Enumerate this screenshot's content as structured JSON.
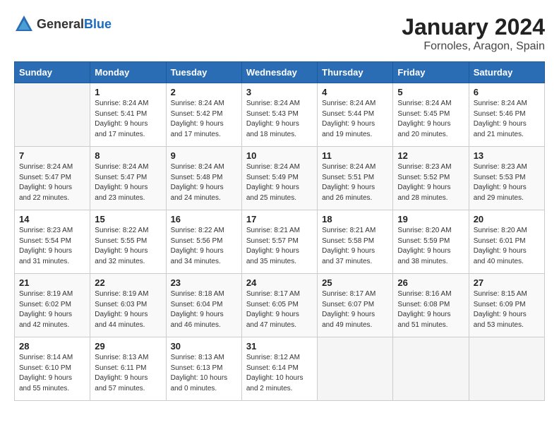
{
  "header": {
    "logo_general": "General",
    "logo_blue": "Blue",
    "month_title": "January 2024",
    "location": "Fornoles, Aragon, Spain"
  },
  "days_of_week": [
    "Sunday",
    "Monday",
    "Tuesday",
    "Wednesday",
    "Thursday",
    "Friday",
    "Saturday"
  ],
  "weeks": [
    [
      {
        "day": "",
        "sunrise": "",
        "sunset": "",
        "daylight": ""
      },
      {
        "day": "1",
        "sunrise": "Sunrise: 8:24 AM",
        "sunset": "Sunset: 5:41 PM",
        "daylight": "Daylight: 9 hours and 17 minutes."
      },
      {
        "day": "2",
        "sunrise": "Sunrise: 8:24 AM",
        "sunset": "Sunset: 5:42 PM",
        "daylight": "Daylight: 9 hours and 17 minutes."
      },
      {
        "day": "3",
        "sunrise": "Sunrise: 8:24 AM",
        "sunset": "Sunset: 5:43 PM",
        "daylight": "Daylight: 9 hours and 18 minutes."
      },
      {
        "day": "4",
        "sunrise": "Sunrise: 8:24 AM",
        "sunset": "Sunset: 5:44 PM",
        "daylight": "Daylight: 9 hours and 19 minutes."
      },
      {
        "day": "5",
        "sunrise": "Sunrise: 8:24 AM",
        "sunset": "Sunset: 5:45 PM",
        "daylight": "Daylight: 9 hours and 20 minutes."
      },
      {
        "day": "6",
        "sunrise": "Sunrise: 8:24 AM",
        "sunset": "Sunset: 5:46 PM",
        "daylight": "Daylight: 9 hours and 21 minutes."
      }
    ],
    [
      {
        "day": "7",
        "sunrise": "Sunrise: 8:24 AM",
        "sunset": "Sunset: 5:47 PM",
        "daylight": "Daylight: 9 hours and 22 minutes."
      },
      {
        "day": "8",
        "sunrise": "Sunrise: 8:24 AM",
        "sunset": "Sunset: 5:47 PM",
        "daylight": "Daylight: 9 hours and 23 minutes."
      },
      {
        "day": "9",
        "sunrise": "Sunrise: 8:24 AM",
        "sunset": "Sunset: 5:48 PM",
        "daylight": "Daylight: 9 hours and 24 minutes."
      },
      {
        "day": "10",
        "sunrise": "Sunrise: 8:24 AM",
        "sunset": "Sunset: 5:49 PM",
        "daylight": "Daylight: 9 hours and 25 minutes."
      },
      {
        "day": "11",
        "sunrise": "Sunrise: 8:24 AM",
        "sunset": "Sunset: 5:51 PM",
        "daylight": "Daylight: 9 hours and 26 minutes."
      },
      {
        "day": "12",
        "sunrise": "Sunrise: 8:23 AM",
        "sunset": "Sunset: 5:52 PM",
        "daylight": "Daylight: 9 hours and 28 minutes."
      },
      {
        "day": "13",
        "sunrise": "Sunrise: 8:23 AM",
        "sunset": "Sunset: 5:53 PM",
        "daylight": "Daylight: 9 hours and 29 minutes."
      }
    ],
    [
      {
        "day": "14",
        "sunrise": "Sunrise: 8:23 AM",
        "sunset": "Sunset: 5:54 PM",
        "daylight": "Daylight: 9 hours and 31 minutes."
      },
      {
        "day": "15",
        "sunrise": "Sunrise: 8:22 AM",
        "sunset": "Sunset: 5:55 PM",
        "daylight": "Daylight: 9 hours and 32 minutes."
      },
      {
        "day": "16",
        "sunrise": "Sunrise: 8:22 AM",
        "sunset": "Sunset: 5:56 PM",
        "daylight": "Daylight: 9 hours and 34 minutes."
      },
      {
        "day": "17",
        "sunrise": "Sunrise: 8:21 AM",
        "sunset": "Sunset: 5:57 PM",
        "daylight": "Daylight: 9 hours and 35 minutes."
      },
      {
        "day": "18",
        "sunrise": "Sunrise: 8:21 AM",
        "sunset": "Sunset: 5:58 PM",
        "daylight": "Daylight: 9 hours and 37 minutes."
      },
      {
        "day": "19",
        "sunrise": "Sunrise: 8:20 AM",
        "sunset": "Sunset: 5:59 PM",
        "daylight": "Daylight: 9 hours and 38 minutes."
      },
      {
        "day": "20",
        "sunrise": "Sunrise: 8:20 AM",
        "sunset": "Sunset: 6:01 PM",
        "daylight": "Daylight: 9 hours and 40 minutes."
      }
    ],
    [
      {
        "day": "21",
        "sunrise": "Sunrise: 8:19 AM",
        "sunset": "Sunset: 6:02 PM",
        "daylight": "Daylight: 9 hours and 42 minutes."
      },
      {
        "day": "22",
        "sunrise": "Sunrise: 8:19 AM",
        "sunset": "Sunset: 6:03 PM",
        "daylight": "Daylight: 9 hours and 44 minutes."
      },
      {
        "day": "23",
        "sunrise": "Sunrise: 8:18 AM",
        "sunset": "Sunset: 6:04 PM",
        "daylight": "Daylight: 9 hours and 46 minutes."
      },
      {
        "day": "24",
        "sunrise": "Sunrise: 8:17 AM",
        "sunset": "Sunset: 6:05 PM",
        "daylight": "Daylight: 9 hours and 47 minutes."
      },
      {
        "day": "25",
        "sunrise": "Sunrise: 8:17 AM",
        "sunset": "Sunset: 6:07 PM",
        "daylight": "Daylight: 9 hours and 49 minutes."
      },
      {
        "day": "26",
        "sunrise": "Sunrise: 8:16 AM",
        "sunset": "Sunset: 6:08 PM",
        "daylight": "Daylight: 9 hours and 51 minutes."
      },
      {
        "day": "27",
        "sunrise": "Sunrise: 8:15 AM",
        "sunset": "Sunset: 6:09 PM",
        "daylight": "Daylight: 9 hours and 53 minutes."
      }
    ],
    [
      {
        "day": "28",
        "sunrise": "Sunrise: 8:14 AM",
        "sunset": "Sunset: 6:10 PM",
        "daylight": "Daylight: 9 hours and 55 minutes."
      },
      {
        "day": "29",
        "sunrise": "Sunrise: 8:13 AM",
        "sunset": "Sunset: 6:11 PM",
        "daylight": "Daylight: 9 hours and 57 minutes."
      },
      {
        "day": "30",
        "sunrise": "Sunrise: 8:13 AM",
        "sunset": "Sunset: 6:13 PM",
        "daylight": "Daylight: 10 hours and 0 minutes."
      },
      {
        "day": "31",
        "sunrise": "Sunrise: 8:12 AM",
        "sunset": "Sunset: 6:14 PM",
        "daylight": "Daylight: 10 hours and 2 minutes."
      },
      {
        "day": "",
        "sunrise": "",
        "sunset": "",
        "daylight": ""
      },
      {
        "day": "",
        "sunrise": "",
        "sunset": "",
        "daylight": ""
      },
      {
        "day": "",
        "sunrise": "",
        "sunset": "",
        "daylight": ""
      }
    ]
  ]
}
